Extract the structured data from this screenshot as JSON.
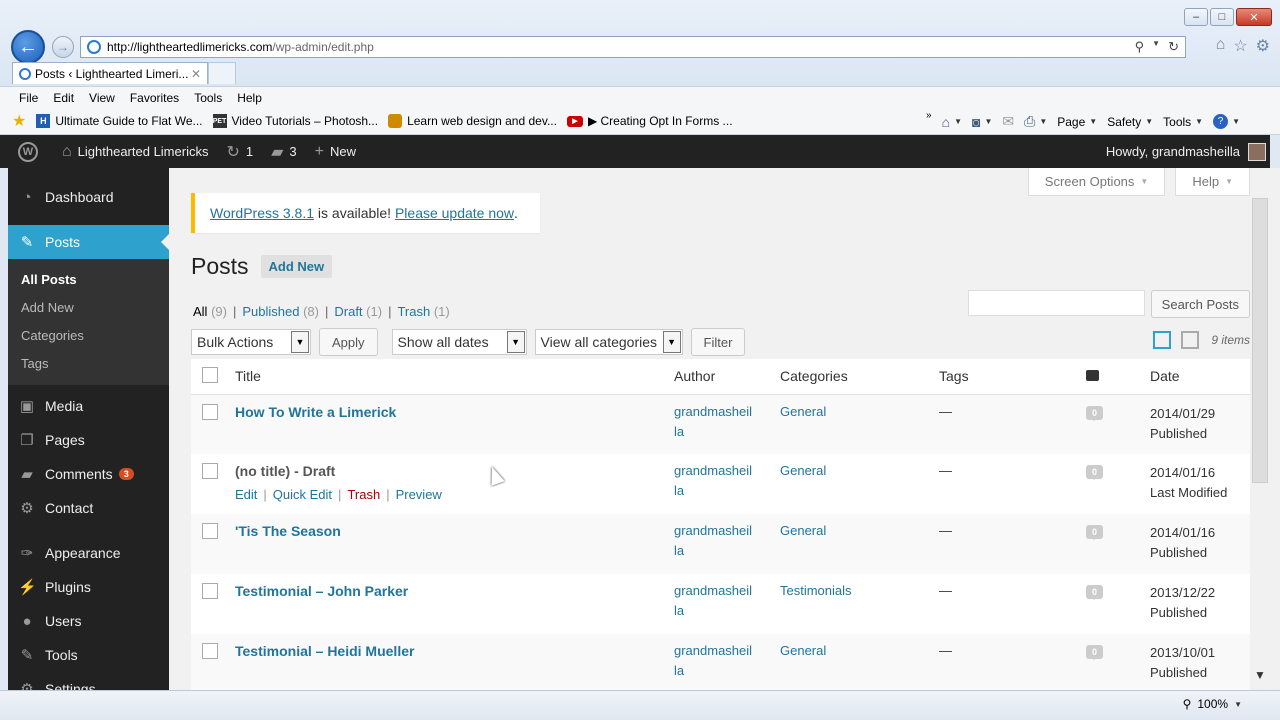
{
  "browser": {
    "url_host": "http://lightheartedlimericks.com",
    "url_path": "/wp-admin/edit.php",
    "tab_title": "Posts ‹ Lighthearted Limeri...",
    "menu": [
      "File",
      "Edit",
      "View",
      "Favorites",
      "Tools",
      "Help"
    ],
    "favorites": [
      {
        "label": "Ultimate Guide to Flat We...",
        "icon": "h-badge-icon",
        "color": "#1f5fb0"
      },
      {
        "label": "Video Tutorials – Photosh...",
        "icon": "pet-badge-icon",
        "color": "#333333"
      },
      {
        "label": "Learn web design and dev...",
        "icon": "tutsplus-icon",
        "color": "#d08a00"
      },
      {
        "label": "▶ Creating Opt In Forms ...",
        "icon": "youtube-icon",
        "color": "#cc0000"
      }
    ],
    "commands": [
      "Page",
      "Safety",
      "Tools"
    ],
    "zoom": "100%"
  },
  "adminbar": {
    "site_name": "Lighthearted Limericks",
    "updates_count": "1",
    "comments_count": "3",
    "new_label": "New",
    "howdy": "Howdy, grandmasheilla"
  },
  "sidebar": {
    "items": [
      {
        "label": "Dashboard",
        "icon": "dashboard-icon"
      },
      {
        "label": "Posts",
        "icon": "pushpin-icon"
      },
      {
        "label": "Media",
        "icon": "media-icon"
      },
      {
        "label": "Pages",
        "icon": "pages-icon"
      },
      {
        "label": "Comments",
        "icon": "comments-icon",
        "badge": "3"
      },
      {
        "label": "Contact",
        "icon": "contact-icon"
      },
      {
        "label": "Appearance",
        "icon": "appearance-icon"
      },
      {
        "label": "Plugins",
        "icon": "plugins-icon"
      },
      {
        "label": "Users",
        "icon": "users-icon"
      },
      {
        "label": "Tools",
        "icon": "tools-icon"
      },
      {
        "label": "Settings",
        "icon": "settings-icon"
      }
    ],
    "posts_submenu": [
      "All Posts",
      "Add New",
      "Categories",
      "Tags"
    ]
  },
  "screen_meta": {
    "screen_options": "Screen Options",
    "help": "Help"
  },
  "notice": {
    "version_link": "WordPress 3.8.1",
    "text": " is available! ",
    "update_link": "Please update now",
    "end": "."
  },
  "page": {
    "title": "Posts",
    "add_new": "Add New"
  },
  "filters": {
    "all": "All",
    "all_count": "(9)",
    "published": "Published",
    "published_count": "(8)",
    "draft": "Draft",
    "draft_count": "(1)",
    "trash": "Trash",
    "trash_count": "(1)"
  },
  "search": {
    "button": "Search Posts"
  },
  "tablenav": {
    "bulk_actions": "Bulk Actions",
    "apply": "Apply",
    "dates": "Show all dates",
    "categories": "View all categories",
    "filter": "Filter",
    "items": "9 items"
  },
  "table": {
    "headers": {
      "title": "Title",
      "author": "Author",
      "categories": "Categories",
      "tags": "Tags",
      "date": "Date"
    },
    "row_actions": {
      "edit": "Edit",
      "quick_edit": "Quick Edit",
      "trash": "Trash",
      "preview": "Preview"
    },
    "rows": [
      {
        "title": "How To Write a Limerick",
        "state": "",
        "author1": "grandmasheil",
        "author2": "la",
        "category": "General",
        "tags": "—",
        "comments": "0",
        "date": "2014/01/29",
        "status": "Published"
      },
      {
        "title": "(no title)",
        "state": " - Draft",
        "author1": "grandmasheil",
        "author2": "la",
        "category": "General",
        "tags": "—",
        "comments": "0",
        "date": "2014/01/16",
        "status": "Last Modified"
      },
      {
        "title": "'Tis The Season",
        "state": "",
        "author1": "grandmasheil",
        "author2": "la",
        "category": "General",
        "tags": "—",
        "comments": "0",
        "date": "2014/01/16",
        "status": "Published"
      },
      {
        "title": "Testimonial – John Parker",
        "state": "",
        "author1": "grandmasheil",
        "author2": "la",
        "category": "Testimonials",
        "tags": "—",
        "comments": "0",
        "date": "2013/12/22",
        "status": "Published"
      },
      {
        "title": "Testimonial – Heidi Mueller",
        "state": "",
        "author1": "grandmasheil",
        "author2": "la",
        "category": "General",
        "tags": "—",
        "comments": "0",
        "date": "2013/10/01",
        "status": "Published"
      }
    ]
  }
}
